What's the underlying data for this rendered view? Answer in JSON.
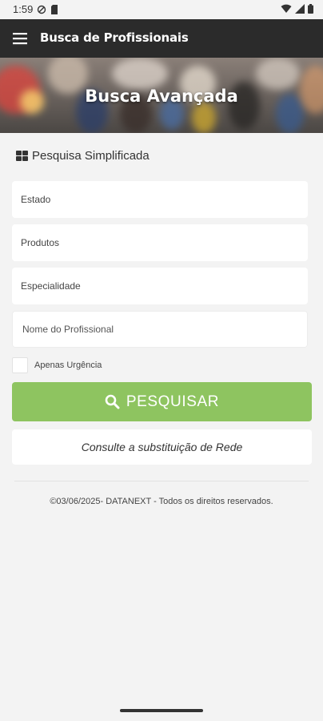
{
  "status_bar": {
    "time": "1:59"
  },
  "app_bar": {
    "title": "Busca de Profissionais"
  },
  "hero": {
    "title": "Busca Avançada"
  },
  "section": {
    "title": "Pesquisa Simplificada"
  },
  "fields": {
    "estado": "Estado",
    "produtos": "Produtos",
    "especialidade": "Especialidade",
    "profissional_placeholder": "Nome do Profissional"
  },
  "checkbox": {
    "label": "Apenas Urgência",
    "checked": false
  },
  "buttons": {
    "search": "PESQUISAR",
    "substitution": "Consulte a substituição de Rede"
  },
  "footer": {
    "text": "©03/06/2025- DATANEXT - Todos os direitos reservados."
  },
  "colors": {
    "app_bar": "#2b2b2b",
    "accent": "#8ec460",
    "background": "#f3f3f3"
  }
}
